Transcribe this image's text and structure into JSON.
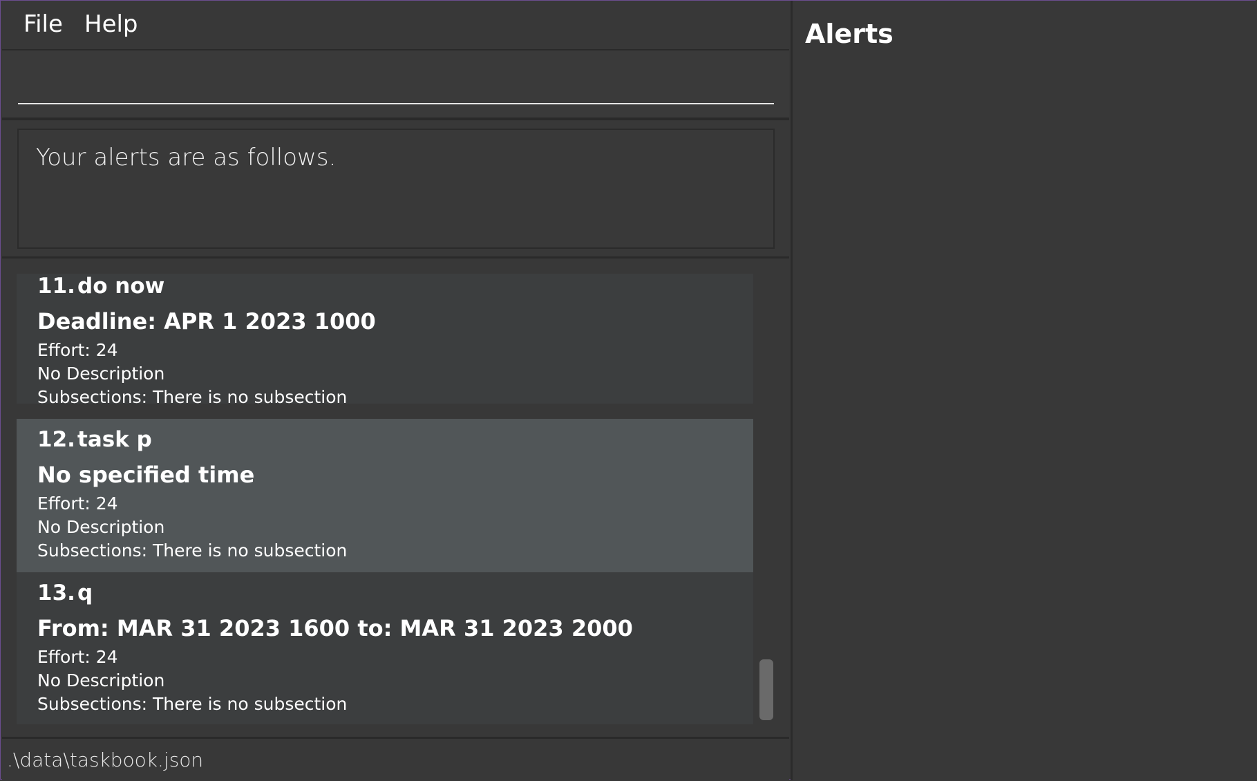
{
  "menu": {
    "file_label": "File",
    "help_label": "Help"
  },
  "command_box": {
    "value": "",
    "placeholder": ""
  },
  "result_display": {
    "text": "Your alerts are as follows."
  },
  "tasks": [
    {
      "index": "11.",
      "name": "do now",
      "time": "Deadline: APR 1 2023 1000",
      "effort": "Effort: 24",
      "description": "No Description",
      "subsections": "Subsections: There is no subsection"
    },
    {
      "index": "12.",
      "name": "task p",
      "time": "No specified time",
      "effort": "Effort: 24",
      "description": "No Description",
      "subsections": "Subsections: There is no subsection"
    },
    {
      "index": "13.",
      "name": "q",
      "time": "From: MAR 31 2023 1600 to: MAR 31 2023 2000",
      "effort": "Effort: 24",
      "description": "No Description",
      "subsections": "Subsections: There is no subsection"
    }
  ],
  "selected_task_index": 1,
  "status_bar": {
    "file_path": ".\\data\\taskbook.json"
  },
  "alerts_panel": {
    "title": "Alerts"
  },
  "colors": {
    "background": "#383838",
    "card": "#3c3e3f",
    "card_selected": "#515658",
    "window_border": "#6b4d8f"
  }
}
